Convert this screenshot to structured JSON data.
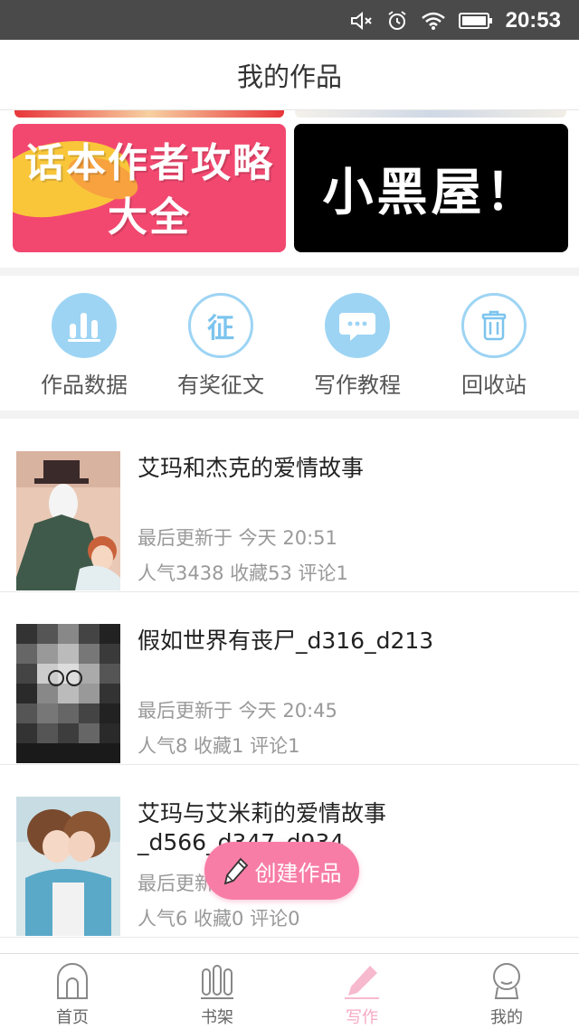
{
  "status_bar": {
    "time": "20:53",
    "icons": [
      "mute-icon",
      "alarm-icon",
      "wifi-icon",
      "battery-icon"
    ]
  },
  "header": {
    "title": "我的作品"
  },
  "banners": [
    {
      "text": "话本作者攻略 大全",
      "color": "#f2486f"
    },
    {
      "text": "小黑屋！",
      "color": "#000000"
    }
  ],
  "quick_actions": [
    {
      "label": "作品数据",
      "icon": "bar-chart-icon"
    },
    {
      "label": "有奖征文",
      "icon": "contest-icon"
    },
    {
      "label": "写作教程",
      "icon": "chat-bubble-icon"
    },
    {
      "label": "回收站",
      "icon": "trash-icon"
    }
  ],
  "works": [
    {
      "title": "艾玛和杰克的爱情故事",
      "updated": "最后更新于 今天 20:51",
      "stats": "人气3438  收藏53  评论1"
    },
    {
      "title": "假如世界有丧尸_d316_d213",
      "updated": "最后更新于 今天 20:45",
      "stats": "人气8  收藏1  评论1"
    },
    {
      "title": "艾玛与艾米莉的爱情故事_d566_d347_d934",
      "updated": "最后更新于 今天 20:37",
      "stats": "人气6  收藏0  评论0"
    }
  ],
  "fab": {
    "label": "创建作品",
    "icon": "pencil-icon",
    "color": "#f77da6"
  },
  "tab_bar": [
    {
      "label": "首页",
      "icon": "home-icon"
    },
    {
      "label": "书架",
      "icon": "bookshelf-icon"
    },
    {
      "label": "写作",
      "icon": "pen-icon",
      "active": true
    },
    {
      "label": "我的",
      "icon": "profile-icon"
    }
  ],
  "colors": {
    "accent": "#f77da6",
    "icon_blue": "#9dd4f4",
    "status_bar": "#4a4a4a"
  }
}
